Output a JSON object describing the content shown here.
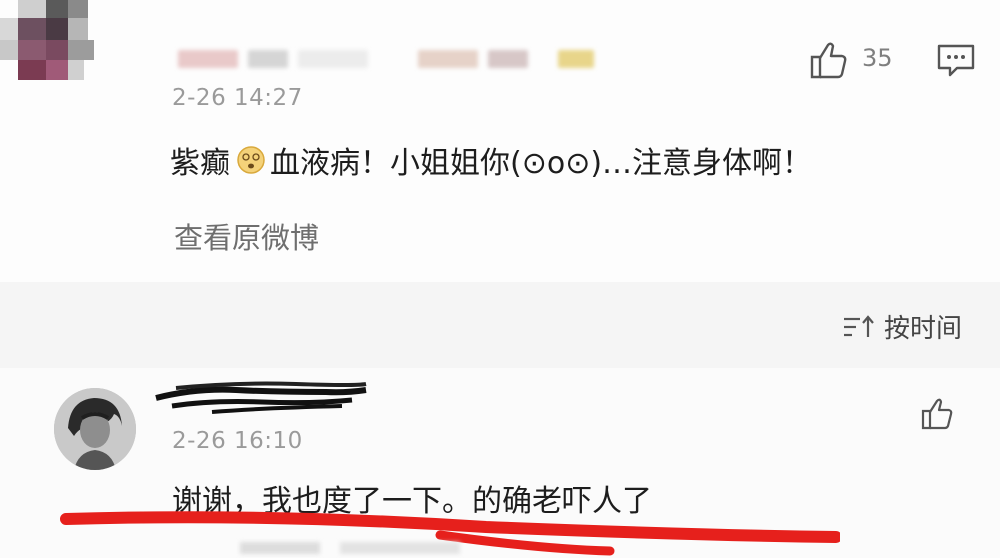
{
  "post": {
    "timestamp": "2-26 14:27",
    "like_count": "35",
    "comment_parts": {
      "before_emoji": "紫癫",
      "emoji": "dizzy-face-emoji",
      "after_emoji": "血液病！小姐姐你(⊙o⊙)…注意身体啊！"
    },
    "view_original_label": "查看原微博"
  },
  "sort": {
    "label": "按时间",
    "icon": "sort-icon"
  },
  "reply": {
    "timestamp": "2-26 16:10",
    "text": "谢谢，我也度了一下。的确老吓人了"
  },
  "colors": {
    "timestamp_gray": "#9a9a9a",
    "link_gray": "#6e6e6e",
    "separator_bg": "#f5f5f5",
    "red_underline": "#e6201c"
  }
}
